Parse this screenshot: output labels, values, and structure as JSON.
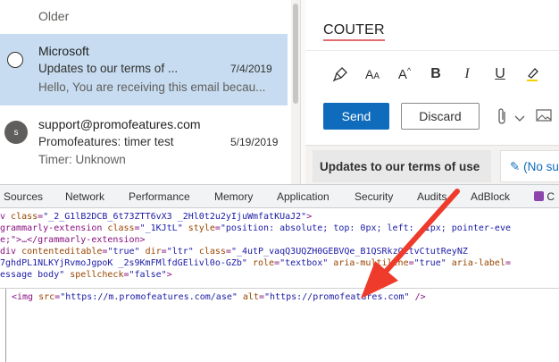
{
  "mail_list": {
    "group_label": "Older",
    "messages": [
      {
        "sender": "Microsoft",
        "subject": "Updates to our terms of ...",
        "date": "7/4/2019",
        "preview": "Hello, You are receiving this email becau...",
        "selected": true
      },
      {
        "avatar": "s",
        "sender": "support@promofeatures.com",
        "subject": "Promofeatures: timer test",
        "date": "5/19/2019",
        "preview": "Timer: Unknown",
        "selected": false
      }
    ]
  },
  "compose": {
    "subject": "COUTER",
    "toolbar_icons": [
      "paintbrush-icon",
      "font-size-icon",
      "font-grow-icon",
      "bold-icon",
      "italic-icon",
      "underline-icon",
      "highlighter-icon"
    ],
    "send_label": "Send",
    "discard_label": "Discard",
    "draft_tab_label": "Updates to our terms of use",
    "reply_tab_label": "(No su"
  },
  "devtools": {
    "tabs": [
      "Sources",
      "Network",
      "Performance",
      "Memory",
      "Application",
      "Security",
      "Audits",
      "AdBlock",
      "C"
    ],
    "code": {
      "line1": {
        "tag_open": "v ",
        "class_attr": "class",
        "class_val": "\"_2_G1lB2DCB_6t73ZTT6vX3 _2Hl0t2u2yIjuWmfatKUaJ2\"",
        "close": ">"
      },
      "line2": {
        "prefix": "grammarly-extension ",
        "class_attr": "class",
        "class_val": "\"_1KJtL\"",
        "style_attr": " style",
        "style_val": "\"position: absolute; top: 0px; left: -1px; pointer-eve"
      },
      "line3": {
        "text": "e;\">…</grammarly-extension>"
      },
      "line4": {
        "prefix": "div ",
        "ce_attr": "contenteditable",
        "ce_val": "\"true\"",
        "dir_attr": " dir",
        "dir_val": "\"ltr\"",
        "class_attr": " class",
        "class_val": "\"_4utP_vaqQ3UQZH0GEBVQe_B1QSRkzQCtvCtutReyNZ"
      },
      "line5": {
        "text": "7ghdPL1NLKYjRvmoJgpoK _2s9KmFMlfdGElivl0o-GZb\"",
        "role_attr": " role",
        "role_val": "\"textbox\"",
        "aria_attr": " aria-multiline",
        "aria_val": "\"true\"",
        "label_attr": " aria-label"
      },
      "line6": {
        "text": "essage body\"",
        "spell_attr": " spellcheck",
        "spell_val": "\"false\"",
        "close": ">"
      }
    },
    "edit_line": {
      "open": "<img ",
      "src_attr": "src",
      "src_val": "\"https://m.promofeatures.com/ase\"",
      "alt_attr": " alt",
      "alt_val": "\"https://promofeatures.com\"",
      "close": " />"
    }
  },
  "colors": {
    "accent": "#0f6cbd",
    "selected_row": "#c7dcf0",
    "arrow": "#ee3b2b"
  }
}
